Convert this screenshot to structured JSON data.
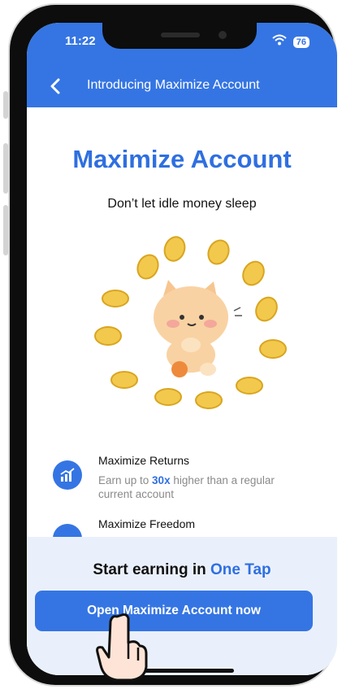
{
  "status_bar": {
    "time": "11:22",
    "battery": "76"
  },
  "header": {
    "title": "Introducing Maximize Account"
  },
  "hero": {
    "title": "Maximize Account",
    "subtitle": "Don’t let idle money sleep"
  },
  "features": [
    {
      "title": "Maximize Returns",
      "desc_before": "Earn up to ",
      "desc_highlight": "30x",
      "desc_after": " higher than a regular current account",
      "icon": "growth-chart-icon"
    },
    {
      "title": "Maximize Freedom",
      "icon": "freedom-icon"
    }
  ],
  "cta": {
    "prefix": "Start earning in ",
    "highlight": "One Tap",
    "button_label": "Open Maximize Account now"
  },
  "colors": {
    "brand_blue": "#3575e3",
    "coin_gold": "#f2c94c",
    "mascot_peach": "#f7c58f"
  }
}
